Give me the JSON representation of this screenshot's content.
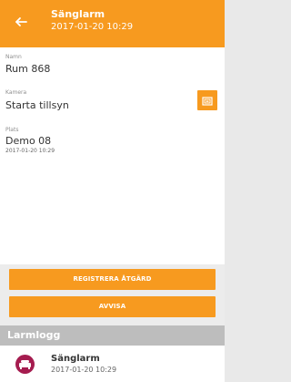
{
  "header": {
    "title": "Sänglarm",
    "subtitle": "2017-01-20 10:29",
    "back_icon": "arrow-left-icon"
  },
  "details": {
    "name_label": "Namn",
    "name_value": "Rum 868",
    "camera_label": "Kamera",
    "camera_value": "Starta tillsyn",
    "camera_icon": "camera-view-icon",
    "place_label": "Plats",
    "place_value": "Demo 08",
    "place_time": "2017-01-20 10:29"
  },
  "actions": {
    "register_label": "REGISTRERA ÅTGÄRD",
    "dismiss_label": "AVVISA"
  },
  "log": {
    "section_title": "Larmlogg",
    "items": [
      {
        "title": "Sänglarm",
        "time": "2017-01-20 10:29",
        "icon": "bed-icon"
      }
    ]
  },
  "colors": {
    "accent": "#f79a1f",
    "section_header": "#bdbdbd",
    "avatar": "#a51c4f"
  }
}
